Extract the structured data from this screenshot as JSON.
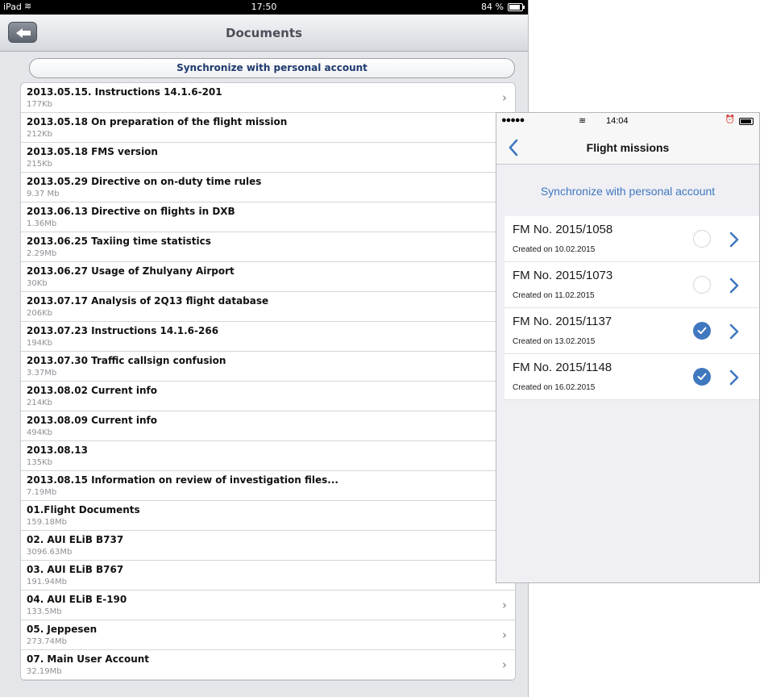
{
  "ipad": {
    "status": {
      "carrier": "iPad",
      "time": "17:50",
      "battery": "84 %"
    },
    "nav": {
      "title": "Documents"
    },
    "sync_label": "Synchronize with personal account",
    "documents": [
      {
        "title": "2013.05.15. Instructions 14.1.6-201",
        "size": "177Kb",
        "chevron": true
      },
      {
        "title": "2013.05.18 On preparation of the flight mission",
        "size": "212Kb",
        "chevron": false
      },
      {
        "title": "2013.05.18 FMS version",
        "size": "215Kb",
        "chevron": false
      },
      {
        "title": "2013.05.29 Directive on on-duty time rules",
        "size": "9.37 Mb",
        "chevron": false
      },
      {
        "title": "2013.06.13 Directive on flights in DXB",
        "size": "1.36Mb",
        "chevron": false
      },
      {
        "title": "2013.06.25 Taxiing time statistics",
        "size": "2.29Mb",
        "chevron": false
      },
      {
        "title": "2013.06.27 Usage of Zhulyany Airport",
        "size": "30Kb",
        "chevron": false
      },
      {
        "title": "2013.07.17 Analysis of 2Q13 flight database",
        "size": "206Kb",
        "chevron": false
      },
      {
        "title": "2013.07.23 Instructions 14.1.6-266",
        "size": "194Kb",
        "chevron": false
      },
      {
        "title": "2013.07.30 Traffic callsign confusion",
        "size": "3.37Mb",
        "chevron": false
      },
      {
        "title": "2013.08.02 Current info",
        "size": "214Kb",
        "chevron": false
      },
      {
        "title": "2013.08.09 Current info",
        "size": "494Kb",
        "chevron": false
      },
      {
        "title": "2013.08.13",
        "size": "135Kb",
        "chevron": false
      },
      {
        "title": "2013.08.15 Information on review of investigation files...",
        "size": "7.19Mb",
        "chevron": false
      },
      {
        "title": "01.Flight Documents",
        "size": "159.18Mb",
        "chevron": false
      },
      {
        "title": "02. AUI ELiB B737",
        "size": "3096.63Mb",
        "chevron": false
      },
      {
        "title": "03. AUI ELiB B767",
        "size": "191.94Mb",
        "chevron": true
      },
      {
        "title": "04. AUI ELiB E-190",
        "size": "133.5Mb",
        "chevron": true
      },
      {
        "title": "05. Jeppesen",
        "size": "273.74Mb",
        "chevron": true
      },
      {
        "title": "07. Main User Account",
        "size": "32.19Mb",
        "chevron": true
      }
    ],
    "chevron_glyph": "›"
  },
  "iphone": {
    "status": {
      "signal": "●●●●●",
      "time": "14:04"
    },
    "nav": {
      "title": "Flight missions"
    },
    "sync_label": "Synchronize with personal account",
    "accent_color": "#3f78bf",
    "missions": [
      {
        "title": "FM No. 2015/1058",
        "created": "Created on 10.02.2015",
        "synced": false
      },
      {
        "title": "FM No. 2015/1073",
        "created": "Created on 11.02.2015",
        "synced": false
      },
      {
        "title": "FM No. 2015/1137",
        "created": "Created on 13.02.2015",
        "synced": true
      },
      {
        "title": "FM No. 2015/1148",
        "created": "Created on 16.02.2015",
        "synced": true
      }
    ]
  }
}
